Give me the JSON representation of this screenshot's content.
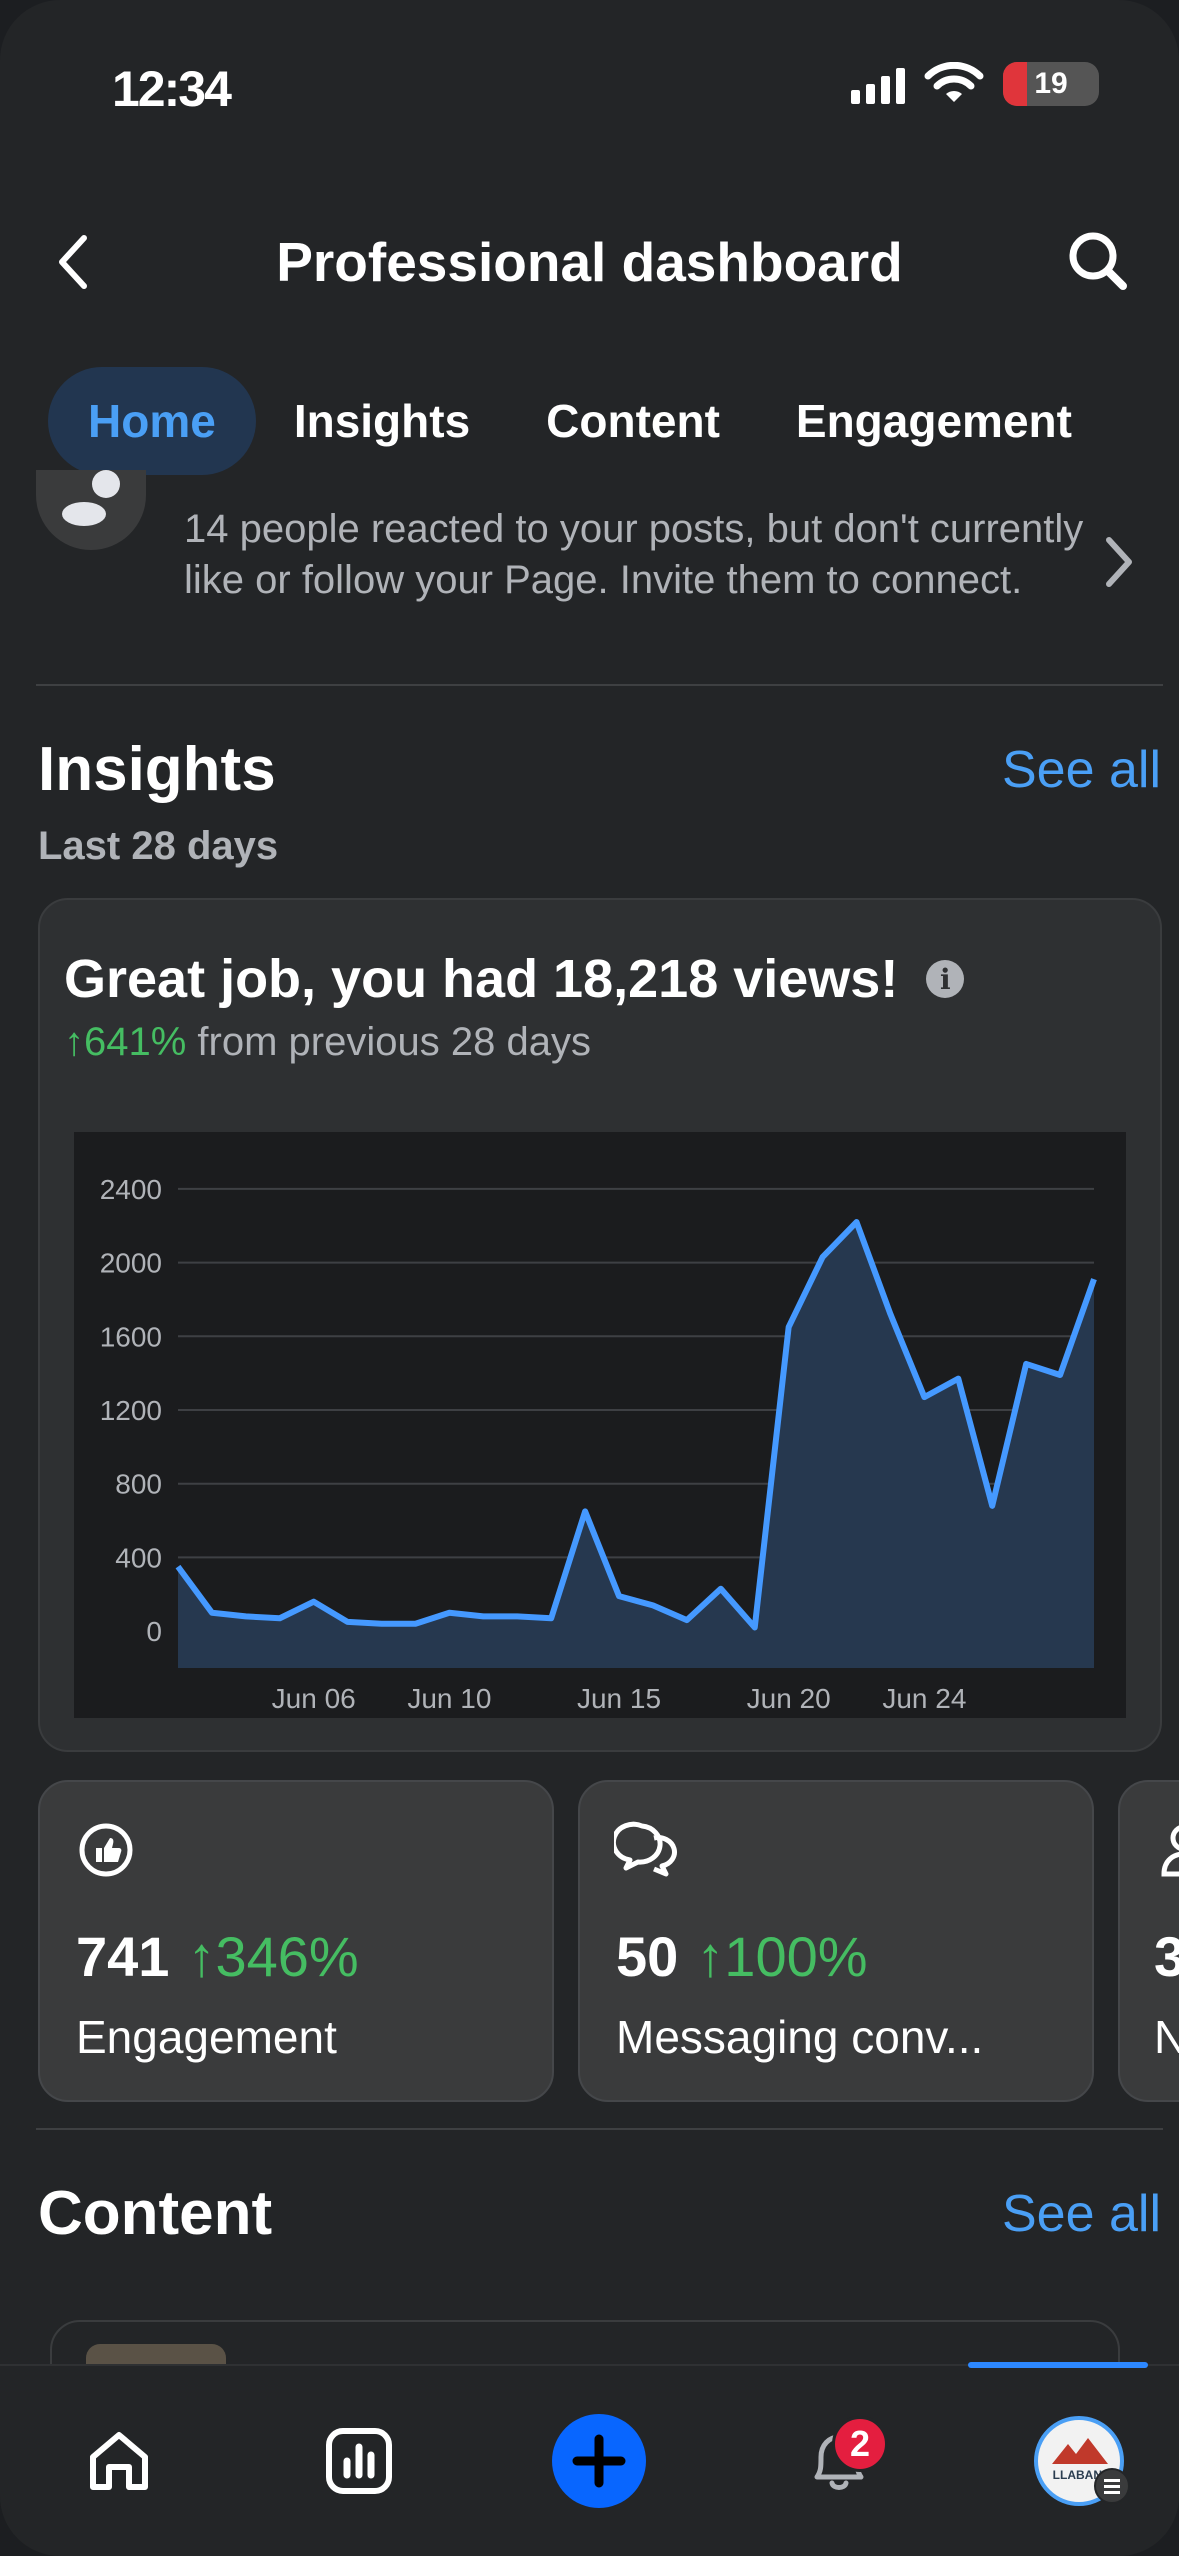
{
  "status_bar": {
    "time": "12:34",
    "battery": "19"
  },
  "header": {
    "title": "Professional dashboard"
  },
  "tabs": [
    {
      "label": "Home",
      "active": true
    },
    {
      "label": "Insights",
      "active": false
    },
    {
      "label": "Content",
      "active": false
    },
    {
      "label": "Engagement",
      "active": false
    }
  ],
  "invite_notice": {
    "text": "14 people reacted to your posts, but don't currently like or follow your Page. Invite them to connect."
  },
  "insights": {
    "title": "Insights",
    "see_all": "See all",
    "period": "Last 28 days",
    "headline": "Great job, you had 18,218 views!",
    "change_pct": "↑641%",
    "change_text": " from previous 28 days"
  },
  "chart_data": {
    "type": "area",
    "x": [
      "Jun 02",
      "Jun 03",
      "Jun 04",
      "Jun 05",
      "Jun 06",
      "Jun 07",
      "Jun 08",
      "Jun 09",
      "Jun 10",
      "Jun 11",
      "Jun 12",
      "Jun 13",
      "Jun 14",
      "Jun 15",
      "Jun 16",
      "Jun 17",
      "Jun 18",
      "Jun 19",
      "Jun 20",
      "Jun 21",
      "Jun 22",
      "Jun 23",
      "Jun 24",
      "Jun 25",
      "Jun 26",
      "Jun 27",
      "Jun 28",
      "Jun 29"
    ],
    "values": [
      350,
      100,
      80,
      70,
      160,
      50,
      40,
      40,
      100,
      80,
      80,
      70,
      650,
      190,
      140,
      60,
      230,
      20,
      1650,
      2030,
      2220,
      1720,
      1270,
      1370,
      680,
      1450,
      1390,
      1910
    ],
    "yticks": [
      0,
      400,
      800,
      1200,
      1600,
      2000,
      2400
    ],
    "xtick_labels": [
      "Jun 06",
      "Jun 10",
      "Jun 15",
      "Jun 20",
      "Jun 24"
    ],
    "ylim": [
      -200,
      2600
    ],
    "grid": true,
    "line_color": "#4599ff",
    "fill_color": "#26384f"
  },
  "metrics": [
    {
      "value": "741",
      "change": "↑346%",
      "label": "Engagement",
      "icon": "engagement-icon"
    },
    {
      "value": "50",
      "change": "↑100%",
      "label": "Messaging conv...",
      "icon": "messaging-icon"
    },
    {
      "value": "3",
      "change": "",
      "label": "N",
      "icon": "person-icon"
    }
  ],
  "content_section": {
    "title": "Content",
    "see_all": "See all"
  },
  "bottom_nav": {
    "items": [
      "home-icon",
      "insights-icon",
      "create-icon",
      "notifications-icon",
      "profile-icon"
    ],
    "notification_count": "2",
    "avatar_text": "LLABANI"
  },
  "colors": {
    "accent": "#4a9ff5",
    "positive": "#45bd62",
    "badge": "#e41e3f",
    "create": "#0866ff"
  }
}
